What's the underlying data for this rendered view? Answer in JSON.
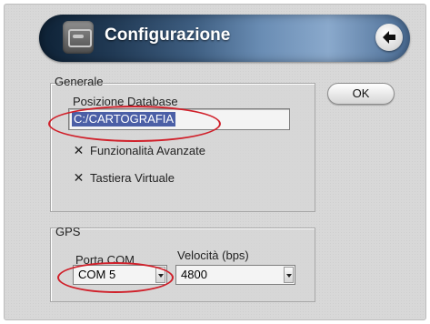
{
  "window": {
    "title": "Configurazione",
    "icon": "hard-drive-icon",
    "back_icon": "arrow-left-icon"
  },
  "general": {
    "label": "Generale",
    "database_label": "Posizione Database",
    "database_value": "C:/CARTOGRAFIA",
    "advanced_label": "Funzionalità Avanzate",
    "advanced_checked": true,
    "keyboard_label": "Tastiera Virtuale",
    "keyboard_checked": true,
    "check_mark": "✕"
  },
  "gps": {
    "label": "GPS",
    "port_label": "Porta COM",
    "port_value": "COM 5",
    "speed_label": "Velocità (bps)",
    "speed_value": "4800"
  },
  "buttons": {
    "ok_label": "OK"
  },
  "colors": {
    "selection": "#4b5fa6",
    "annotation": "#d0202a"
  }
}
